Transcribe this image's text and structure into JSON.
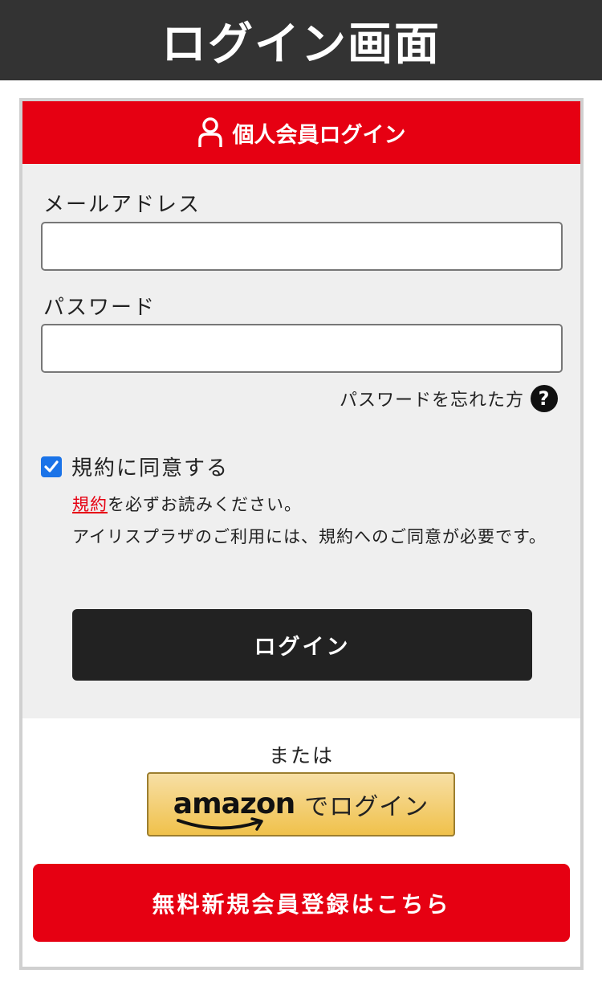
{
  "banner": {
    "title": "ログイン画面"
  },
  "panel": {
    "header_title": "個人会員ログイン",
    "email_label": "メールアドレス",
    "email_value": "",
    "password_label": "パスワード",
    "password_value": "",
    "forgot_label": "パスワードを忘れた方",
    "help_glyph": "?",
    "agree_label": "規約に同意する",
    "agree_checked": true,
    "terms_link": "規約",
    "terms_note_rest": "を必ずお読みください。",
    "terms_note_2": "アイリスプラザのご利用には、規約へのご同意が必要です。",
    "login_button": "ログイン"
  },
  "alt_login": {
    "or_text": "または",
    "amazon_logo": "amazon",
    "amazon_suffix": "でログイン"
  },
  "register_button": "無料新規会員登録はこちら",
  "colors": {
    "accent_red": "#e60012",
    "banner_dark": "#333333",
    "form_bg": "#efefef",
    "login_button_bg": "#222222",
    "amazon_gold": "#f0c14b",
    "checkbox_blue": "#1a73e8"
  },
  "icons": [
    "user-icon",
    "help-icon",
    "checkmark-icon",
    "amazon-smile-icon"
  ]
}
